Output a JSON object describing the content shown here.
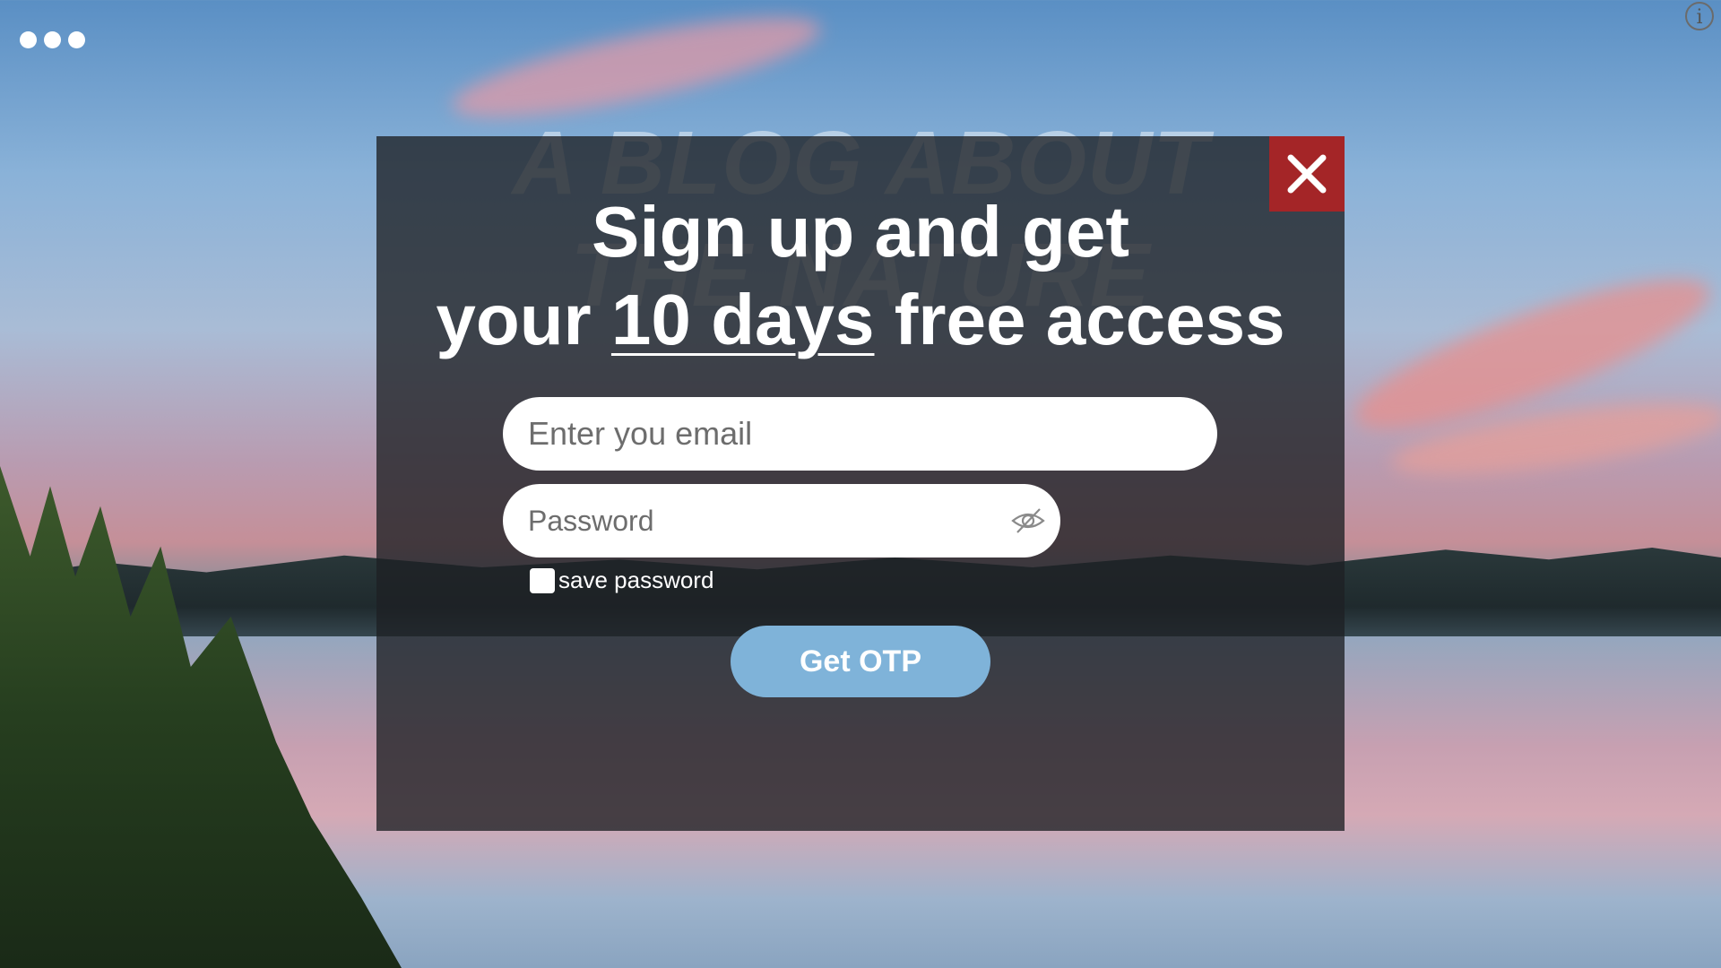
{
  "blog_title": {
    "line1": "A BLOG ABOUT",
    "line2": "THE NATURE"
  },
  "modal": {
    "headline_part1": "Sign up and get",
    "headline_part2": "your ",
    "headline_highlight": "10 days",
    "headline_part3": " free access",
    "email_placeholder": "Enter you email",
    "password_placeholder": "Password",
    "save_password_label": "save password",
    "submit_label": "Get OTP",
    "close_icon": "close-icon",
    "close_color": "#a42527",
    "button_color": "#7fb3d9"
  },
  "topbar": {
    "menu_icon": "more-dots-icon",
    "info_icon": "info-icon",
    "info_glyph": "i"
  }
}
